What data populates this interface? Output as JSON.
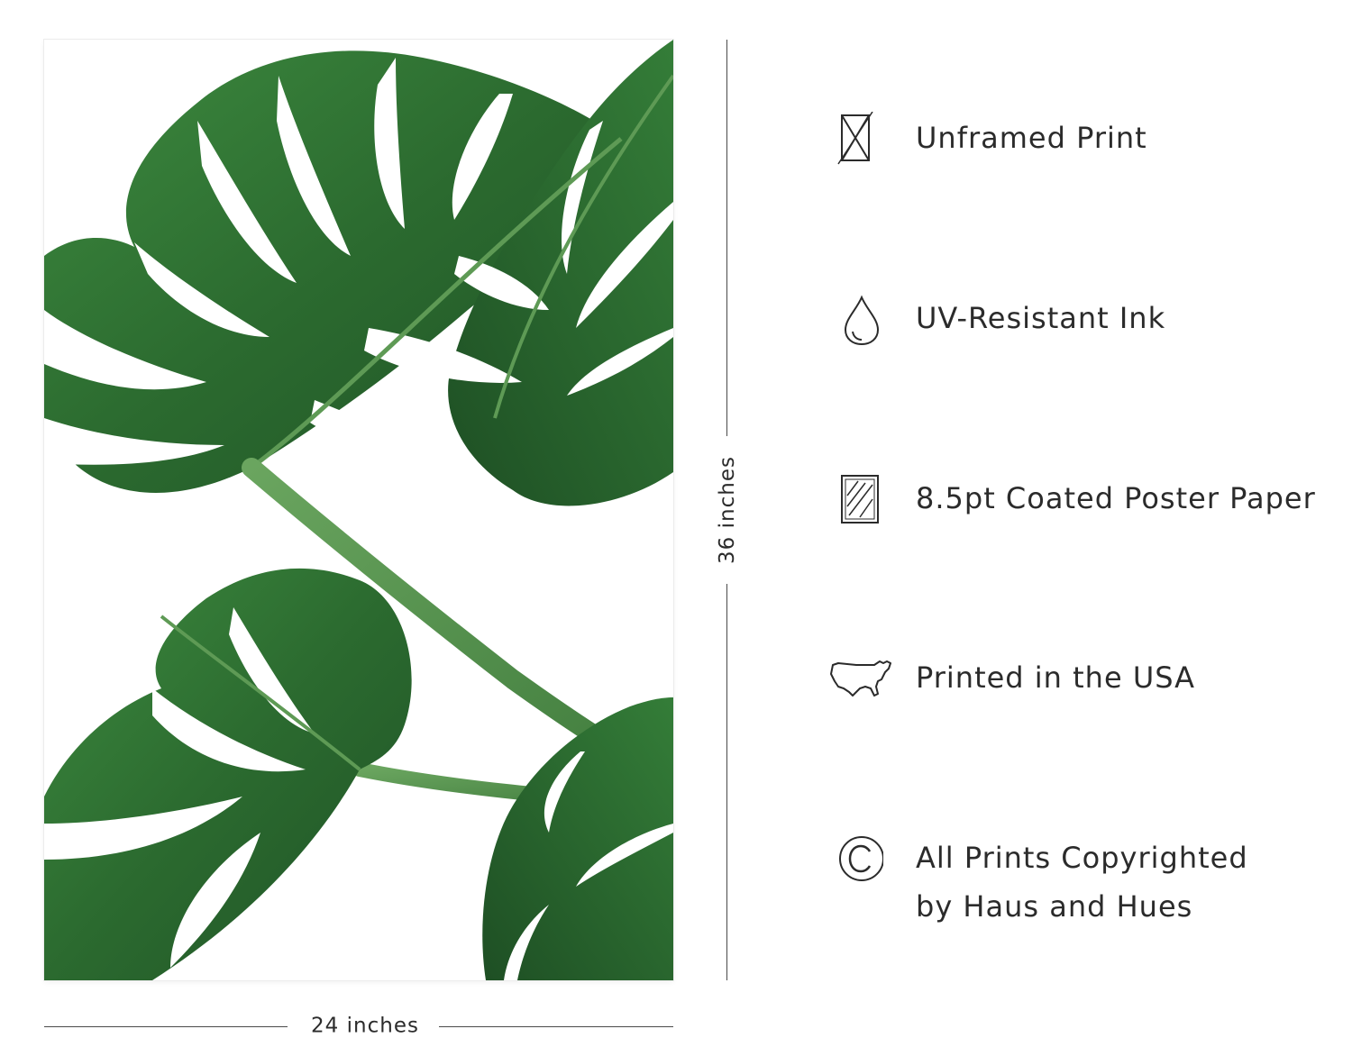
{
  "poster": {
    "leaf_color": "#2f6b34",
    "stem_color": "#4f8e4a"
  },
  "dimensions": {
    "height_label": "36 inches",
    "width_label": "24 inches"
  },
  "features": [
    {
      "icon": "unframed-icon",
      "label": "Unframed Print"
    },
    {
      "icon": "ink-drop-icon",
      "label": "UV-Resistant Ink"
    },
    {
      "icon": "paper-icon",
      "label": "8.5pt Coated Poster Paper"
    },
    {
      "icon": "usa-map-icon",
      "label": "Printed in the USA"
    },
    {
      "icon": "copyright-icon",
      "label_line1": "All Prints Copyrighted",
      "label_line2": "by Haus and Hues"
    }
  ]
}
